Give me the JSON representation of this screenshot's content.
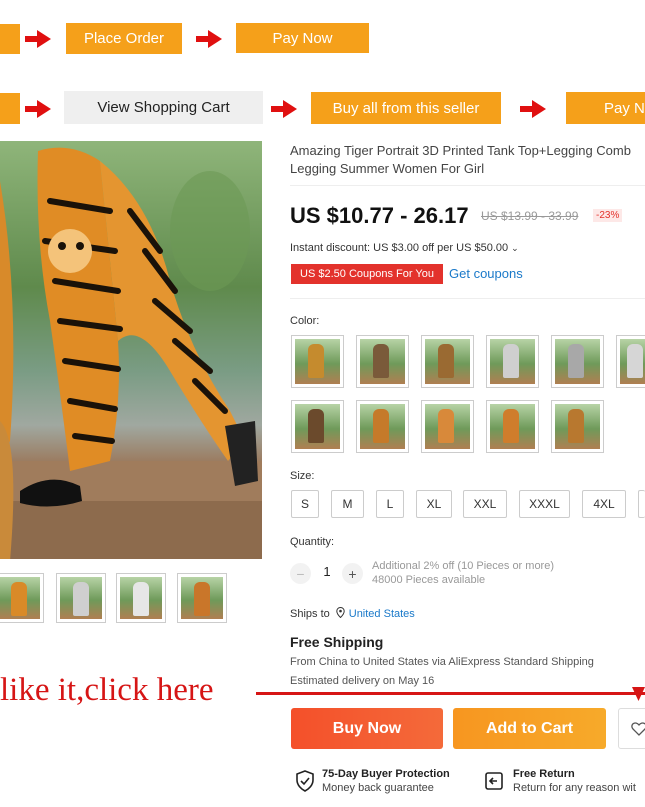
{
  "flow_row1": {
    "btn1": "",
    "btn2": "Place Order",
    "btn3": "Pay Now"
  },
  "flow_row2": {
    "btn1": "",
    "btn2": "View Shopping Cart",
    "btn3": "Buy all from this seller",
    "btn4": "Pay No"
  },
  "product": {
    "title": "Amazing Tiger Portrait 3D Printed Tank Top+Legging Comb Legging Summer Women For Girl",
    "price": "US $10.77 - 26.17",
    "original_price": "US $13.99 - 33.99",
    "discount": "-23%",
    "instant_discount": "Instant discount: US $3.00 off per US $50.00",
    "coupon_badge": "US $2.50 Coupons For You",
    "get_coupons": "Get coupons"
  },
  "color": {
    "label": "Color:",
    "swatch_count": 12
  },
  "size": {
    "label": "Size:",
    "options": [
      "S",
      "M",
      "L",
      "XL",
      "XXL",
      "XXXL",
      "4XL"
    ]
  },
  "quantity": {
    "label": "Quantity:",
    "minus": "−",
    "value": "1",
    "plus": "+",
    "note1": "Additional 2% off (10 Pieces or more)",
    "note2": "48000 Pieces available"
  },
  "shipping": {
    "ships_to_label": "Ships to",
    "ships_to_value": "United States",
    "free_shipping": "Free Shipping",
    "route": "From China to United States via AliExpress Standard Shipping",
    "delivery": "Estimated delivery on May 16"
  },
  "promo_text": "like it,click here",
  "actions": {
    "buy_now": "Buy Now",
    "add_to_cart": "Add to Cart"
  },
  "protection": {
    "title": "75-Day Buyer Protection",
    "sub": "Money back guarantee"
  },
  "return": {
    "title": "Free Return",
    "sub": "Return for any reason wit"
  },
  "colors": {
    "orange_box": "#f5a01a",
    "red_arrow": "#e01010",
    "buy_now": "#f45a2e",
    "add_cart": "#f7a21b",
    "link": "#1a79c9",
    "promo": "#d61515"
  }
}
